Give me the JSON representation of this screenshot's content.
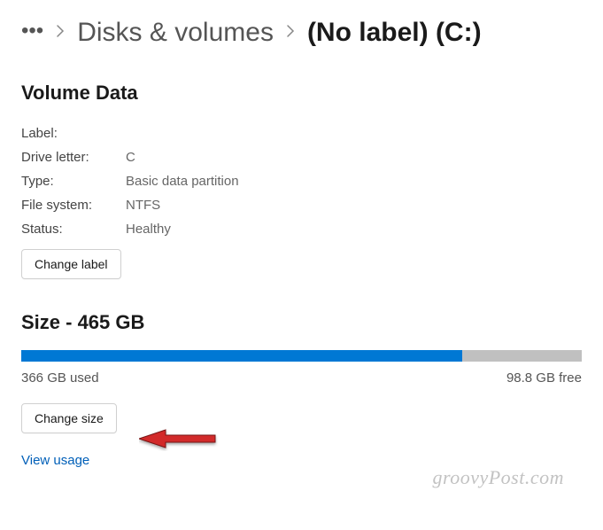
{
  "breadcrumb": {
    "parent": "Disks & volumes",
    "current": "(No label) (C:)"
  },
  "volume_data": {
    "heading": "Volume Data",
    "labels": {
      "label": "Label:",
      "drive_letter": "Drive letter:",
      "type": "Type:",
      "file_system": "File system:",
      "status": "Status:"
    },
    "values": {
      "label": "",
      "drive_letter": "C",
      "type": "Basic data partition",
      "file_system": "NTFS",
      "status": "Healthy"
    },
    "change_label_button": "Change label"
  },
  "size": {
    "heading": "Size - 465 GB",
    "used_text": "366 GB used",
    "free_text": "98.8 GB free",
    "used_percent": 78.7,
    "change_size_button": "Change size",
    "view_usage_link": "View usage"
  },
  "watermark": "groovyPost.com"
}
